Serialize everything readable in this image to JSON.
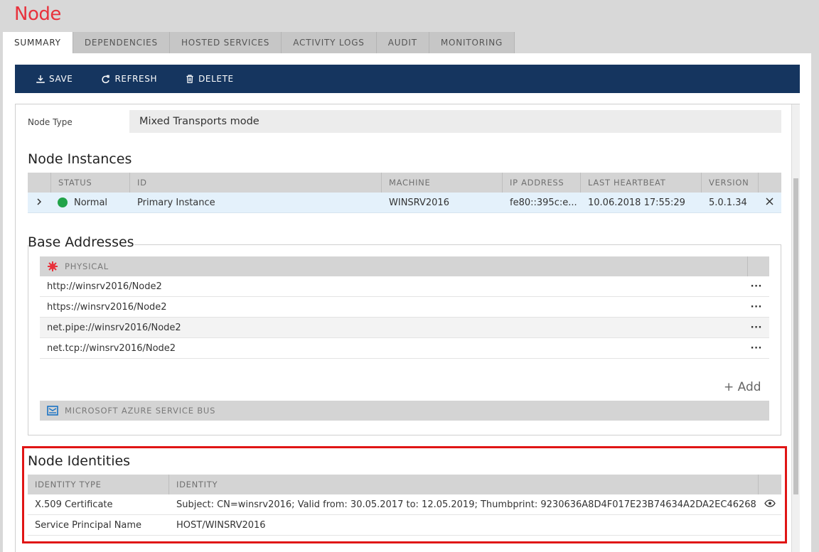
{
  "page": {
    "title": "Node"
  },
  "tabs": [
    {
      "label": "SUMMARY",
      "active": true
    },
    {
      "label": "DEPENDENCIES",
      "active": false
    },
    {
      "label": "HOSTED SERVICES",
      "active": false
    },
    {
      "label": "ACTIVITY LOGS",
      "active": false
    },
    {
      "label": "AUDIT",
      "active": false
    },
    {
      "label": "MONITORING",
      "active": false
    }
  ],
  "toolbar": {
    "save": "SAVE",
    "refresh": "REFRESH",
    "delete": "DELETE"
  },
  "node_type": {
    "label": "Node Type",
    "value": "Mixed Transports mode"
  },
  "instances": {
    "title": "Node Instances",
    "columns": [
      "STATUS",
      "ID",
      "MACHINE",
      "IP ADDRESS",
      "LAST HEARTBEAT",
      "VERSION"
    ],
    "rows": [
      {
        "status": "Normal",
        "id": "Primary Instance",
        "machine": "WINSRV2016",
        "ip": "fe80::395c:e...",
        "heartbeat": "10.06.2018 17:55:29",
        "version": "5.0.1.34"
      }
    ]
  },
  "base_addresses": {
    "title": "Base Addresses",
    "physical": {
      "label": "PHYSICAL",
      "rows": [
        {
          "url": "http://winsrv2016/Node2",
          "menu": "···"
        },
        {
          "url": "https://winsrv2016/Node2",
          "menu": "···"
        },
        {
          "url": "net.pipe://winsrv2016/Node2",
          "menu": "···"
        },
        {
          "url": "net.tcp://winsrv2016/Node2",
          "menu": "···"
        }
      ]
    },
    "add_label": "+ Add",
    "azure": {
      "label": "MICROSOFT AZURE SERVICE BUS"
    }
  },
  "identities": {
    "title": "Node Identities",
    "columns": [
      "IDENTITY TYPE",
      "IDENTITY"
    ],
    "rows": [
      {
        "type": "X.509 Certificate",
        "identity": "Subject: CN=winsrv2016; Valid from: 30.05.2017 to: 12.05.2019; Thumbprint: 9230636A8D4F017E23B74634A2DA2EC46268"
      },
      {
        "type": "Service Principal Name",
        "identity": "HOST/WINSRV2016"
      }
    ]
  },
  "colors": {
    "title_red": "#e8323c",
    "toolbar_navy": "#15355f",
    "status_green": "#21a349",
    "highlight_red": "#e01515"
  },
  "icons": {
    "save": "download-icon",
    "refresh": "refresh-icon",
    "delete": "trash-icon",
    "physical": "network-icon",
    "azure": "service-bus-icon",
    "row_remove": "close-icon",
    "row_expand": "chevron-right-icon",
    "view": "eye-icon"
  }
}
